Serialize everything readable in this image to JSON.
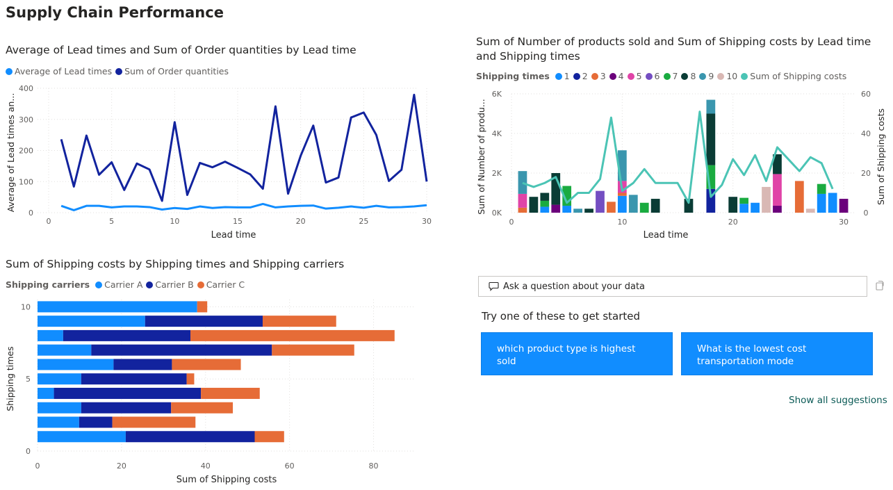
{
  "page_title": "Supply Chain Performance",
  "qa": {
    "placeholder": "Ask a question about your data",
    "try_text": "Try one of these to get started",
    "suggestions": [
      "which product type is highest sold",
      "What is the lowest cost transportation mode"
    ],
    "show_all": "Show all suggestions"
  },
  "chart_data": [
    {
      "type": "line",
      "title": "Average of Lead times and Sum of Order quantities by Lead time",
      "xlabel": "Lead time",
      "ylabel": "Average of Lead times an...",
      "xlim": [
        0,
        30
      ],
      "ylim": [
        0,
        400
      ],
      "x_ticks": [
        0,
        5,
        10,
        15,
        20,
        25,
        30
      ],
      "y_ticks": [
        0,
        100,
        200,
        300,
        400
      ],
      "grid": true,
      "legend_position": "top-left",
      "x": [
        1,
        2,
        3,
        4,
        5,
        6,
        7,
        8,
        9,
        10,
        11,
        12,
        13,
        14,
        15,
        16,
        17,
        18,
        19,
        20,
        21,
        22,
        23,
        24,
        25,
        26,
        27,
        28,
        29,
        30
      ],
      "series": [
        {
          "name": "Average of Lead times",
          "color": "#118dff",
          "values": [
            22,
            8,
            22,
            22,
            17,
            20,
            20,
            18,
            10,
            15,
            12,
            20,
            15,
            18,
            17,
            17,
            28,
            17,
            20,
            22,
            23,
            13,
            16,
            20,
            16,
            22,
            17,
            18,
            20,
            24
          ]
        },
        {
          "name": "Sum of Order quantities",
          "color": "#12239e",
          "values": [
            236,
            84,
            248,
            122,
            162,
            73,
            158,
            139,
            38,
            291,
            57,
            160,
            146,
            164,
            144,
            123,
            77,
            342,
            61,
            183,
            280,
            97,
            113,
            306,
            322,
            250,
            102,
            138,
            379,
            100
          ]
        }
      ]
    },
    {
      "type": "bar",
      "orientation": "stacked-column-with-line",
      "title": "Sum of Number of products sold and Sum of Shipping costs by Lead time and Shipping times",
      "xlabel": "Lead time",
      "ylabel": "Sum of Number of produ...",
      "y2label": "Sum of Shipping costs",
      "legend_title": "Shipping times",
      "xlim": [
        0,
        31
      ],
      "ylim": [
        0,
        6000
      ],
      "y2lim": [
        0,
        60
      ],
      "x_ticks": [
        0,
        10,
        20,
        30
      ],
      "y_tick_labels": [
        "0K",
        "2K",
        "4K",
        "6K"
      ],
      "y2_ticks": [
        0,
        20,
        40,
        60
      ],
      "grid": true,
      "legend_position": "top-left",
      "categories": [
        1,
        2,
        3,
        4,
        5,
        6,
        7,
        8,
        9,
        10,
        11,
        12,
        13,
        14,
        15,
        16,
        17,
        18,
        19,
        20,
        21,
        22,
        23,
        24,
        25,
        26,
        27,
        28,
        29,
        30
      ],
      "series": [
        {
          "name": "1",
          "color": "#118dff",
          "values": [
            0,
            0,
            300,
            0,
            350,
            0,
            0,
            0,
            0,
            850,
            0,
            0,
            0,
            0,
            0,
            0,
            0,
            0,
            0,
            0,
            450,
            500,
            0,
            0,
            0,
            0,
            0,
            950,
            1000,
            0
          ]
        },
        {
          "name": "2",
          "color": "#12239e",
          "values": [
            0,
            0,
            0,
            0,
            0,
            0,
            0,
            0,
            0,
            0,
            0,
            0,
            0,
            0,
            0,
            0,
            0,
            1200,
            0,
            0,
            0,
            0,
            0,
            0,
            0,
            0,
            0,
            0,
            0,
            0
          ]
        },
        {
          "name": "3",
          "color": "#e66c37",
          "values": [
            250,
            0,
            0,
            0,
            0,
            0,
            0,
            0,
            550,
            150,
            0,
            0,
            0,
            0,
            0,
            0,
            0,
            0,
            0,
            0,
            0,
            0,
            0,
            0,
            0,
            1600,
            0,
            0,
            0,
            0
          ]
        },
        {
          "name": "4",
          "color": "#6b007b",
          "values": [
            0,
            0,
            0,
            400,
            0,
            0,
            0,
            0,
            0,
            0,
            0,
            0,
            0,
            0,
            0,
            0,
            0,
            0,
            0,
            0,
            0,
            0,
            0,
            350,
            0,
            0,
            0,
            0,
            0,
            700
          ]
        },
        {
          "name": "5",
          "color": "#e044a7",
          "values": [
            700,
            0,
            0,
            0,
            0,
            0,
            0,
            0,
            0,
            600,
            0,
            0,
            0,
            0,
            0,
            0,
            0,
            0,
            0,
            0,
            0,
            0,
            0,
            1600,
            0,
            0,
            0,
            0,
            0,
            0
          ]
        },
        {
          "name": "6",
          "color": "#744ec2",
          "values": [
            0,
            0,
            0,
            0,
            0,
            0,
            0,
            1100,
            0,
            0,
            0,
            0,
            0,
            0,
            0,
            0,
            0,
            0,
            0,
            0,
            0,
            0,
            0,
            0,
            0,
            0,
            0,
            0,
            0,
            0
          ]
        },
        {
          "name": "7",
          "color": "#1aab40",
          "values": [
            0,
            0,
            300,
            0,
            1000,
            0,
            0,
            0,
            0,
            0,
            0,
            500,
            0,
            0,
            0,
            0,
            0,
            1200,
            0,
            0,
            300,
            0,
            0,
            0,
            0,
            0,
            0,
            500,
            0,
            0
          ]
        },
        {
          "name": "8",
          "color": "#0a3c35",
          "values": [
            0,
            800,
            400,
            1600,
            0,
            0,
            200,
            0,
            0,
            0,
            0,
            0,
            700,
            0,
            0,
            700,
            0,
            2600,
            0,
            800,
            0,
            0,
            0,
            1000,
            0,
            0,
            0,
            0,
            0,
            0
          ]
        },
        {
          "name": "9",
          "color": "#3a96ae",
          "values": [
            1150,
            0,
            0,
            0,
            0,
            200,
            0,
            0,
            0,
            1550,
            900,
            0,
            0,
            0,
            0,
            0,
            0,
            700,
            0,
            0,
            0,
            0,
            0,
            0,
            0,
            0,
            0,
            0,
            0,
            0
          ]
        },
        {
          "name": "10",
          "color": "#d9b8b4",
          "values": [
            0,
            0,
            0,
            0,
            0,
            0,
            0,
            0,
            0,
            0,
            0,
            0,
            0,
            0,
            0,
            0,
            0,
            0,
            0,
            0,
            0,
            0,
            1300,
            0,
            0,
            0,
            200,
            0,
            0,
            0
          ]
        }
      ],
      "line_series": {
        "name": "Sum of Shipping costs",
        "color": "#4bc4b5",
        "values": [
          15,
          13,
          15,
          18,
          5,
          10,
          10,
          17,
          48,
          11,
          15,
          22,
          15,
          15,
          15,
          5,
          51,
          8,
          14,
          27,
          19,
          29,
          16,
          33,
          27,
          21,
          28,
          25,
          12,
          null
        ]
      }
    },
    {
      "type": "bar",
      "orientation": "stacked-horizontal",
      "title": "Sum of Shipping costs by Shipping times and Shipping carriers",
      "xlabel": "Sum of Shipping costs",
      "ylabel": "Shipping times",
      "legend_title": "Shipping carriers",
      "xlim": [
        0,
        90
      ],
      "x_ticks": [
        0,
        20,
        40,
        60,
        80
      ],
      "y_tick_labels": [
        "10",
        "5",
        "0"
      ],
      "grid": true,
      "legend_position": "top-left",
      "categories": [
        10,
        9,
        8,
        7,
        6,
        5,
        4,
        3,
        2,
        1
      ],
      "series": [
        {
          "name": "Carrier A",
          "color": "#118dff",
          "values": [
            38,
            25.6,
            6.1,
            12.8,
            18.1,
            10.4,
            3.9,
            10.4,
            9.9,
            21
          ]
        },
        {
          "name": "Carrier B",
          "color": "#12239e",
          "values": [
            0,
            28,
            30.3,
            43,
            13.9,
            25.1,
            35,
            21.4,
            7.9,
            30.7
          ]
        },
        {
          "name": "Carrier C",
          "color": "#e66c37",
          "values": [
            2.4,
            17.5,
            48.6,
            19.6,
            16.4,
            1.8,
            14,
            14.7,
            19.8,
            7
          ]
        }
      ]
    }
  ]
}
